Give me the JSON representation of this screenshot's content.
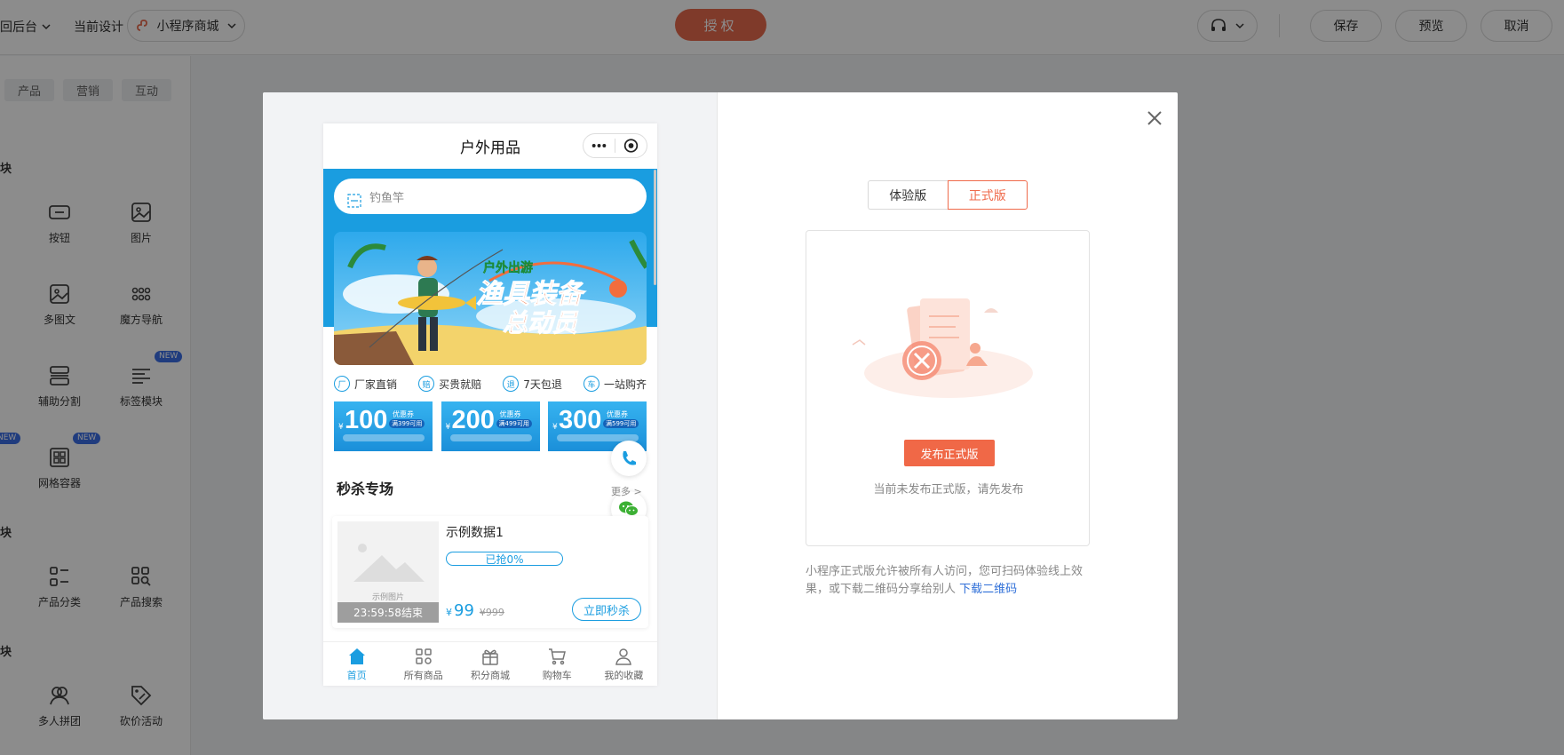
{
  "topbar": {
    "backend_label": "回后台",
    "current_design_label": "当前设计",
    "design_select": "小程序商城",
    "auth_button": "授权",
    "save_button": "保存",
    "preview_button": "预览",
    "cancel_button": "取消"
  },
  "left_panel": {
    "tabs": [
      "产品",
      "营销",
      "互动"
    ],
    "sections": [
      "块",
      "块",
      "块"
    ],
    "components": [
      {
        "label": "按钮",
        "icon": "button-icon"
      },
      {
        "label": "图片",
        "icon": "image-icon"
      },
      {
        "label": "多图文",
        "icon": "multi-image-icon"
      },
      {
        "label": "魔方导航",
        "icon": "grid-dots-icon"
      },
      {
        "label": "辅助分割",
        "icon": "divider-icon"
      },
      {
        "label": "标签模块",
        "icon": "tag-list-icon",
        "badge": "NEW"
      },
      {
        "label": "网格容器",
        "icon": "grid-container-icon",
        "badge": "NEW"
      },
      {
        "label": "产品分类",
        "icon": "category-icon"
      },
      {
        "label": "产品搜索",
        "icon": "product-search-icon"
      },
      {
        "label": "多人拼团",
        "icon": "group-buy-icon"
      },
      {
        "label": "砍价活动",
        "icon": "bargain-icon"
      }
    ],
    "edge_badge": "NEW"
  },
  "phone": {
    "title": "户外用品",
    "search_placeholder": "钓鱼竿",
    "banner": {
      "tag": "户外出游",
      "line1": "渔具装备",
      "line2": "总动员"
    },
    "features": [
      {
        "icon": "厂",
        "label": "厂家直销"
      },
      {
        "icon": "赔",
        "label": "买贵就赔"
      },
      {
        "icon": "退",
        "label": "7天包退"
      },
      {
        "icon": "车",
        "label": "一站购齐"
      }
    ],
    "coupons": [
      {
        "yen": "¥",
        "amount": "100",
        "type": "优惠券",
        "cond": "满399可用"
      },
      {
        "yen": "¥",
        "amount": "200",
        "type": "优惠券",
        "cond": "满499可用"
      },
      {
        "yen": "¥",
        "amount": "300",
        "type": "优惠券",
        "cond": "满599可用"
      }
    ],
    "flash_sale": {
      "title": "秒杀专场",
      "more": "更多 >",
      "product": {
        "image_text": "示例图片",
        "timer": "23:59:58结束",
        "name": "示例数据1",
        "progress": "已抢0%",
        "yen": "¥",
        "price": "99",
        "old_price": "¥999",
        "buy": "立即秒杀"
      }
    },
    "nav": [
      {
        "label": "首页",
        "icon": "home-icon",
        "active": true
      },
      {
        "label": "所有商品",
        "icon": "grid-icon"
      },
      {
        "label": "积分商城",
        "icon": "gift-icon"
      },
      {
        "label": "购物车",
        "icon": "cart-icon"
      },
      {
        "label": "我的收藏",
        "icon": "user-icon"
      }
    ]
  },
  "publish_panel": {
    "version_tabs": [
      "体验版",
      "正式版"
    ],
    "publish_button": "发布正式版",
    "hint": "当前未发布正式版，请先发布",
    "desc": "小程序正式版允许被所有人访问，您可扫码体验线上效果，或下载二维码分享给别人",
    "download_link": "下载二维码"
  },
  "colors": {
    "accent": "#f06847",
    "brand_blue": "#1a9de0",
    "overlay": "#00000073"
  }
}
